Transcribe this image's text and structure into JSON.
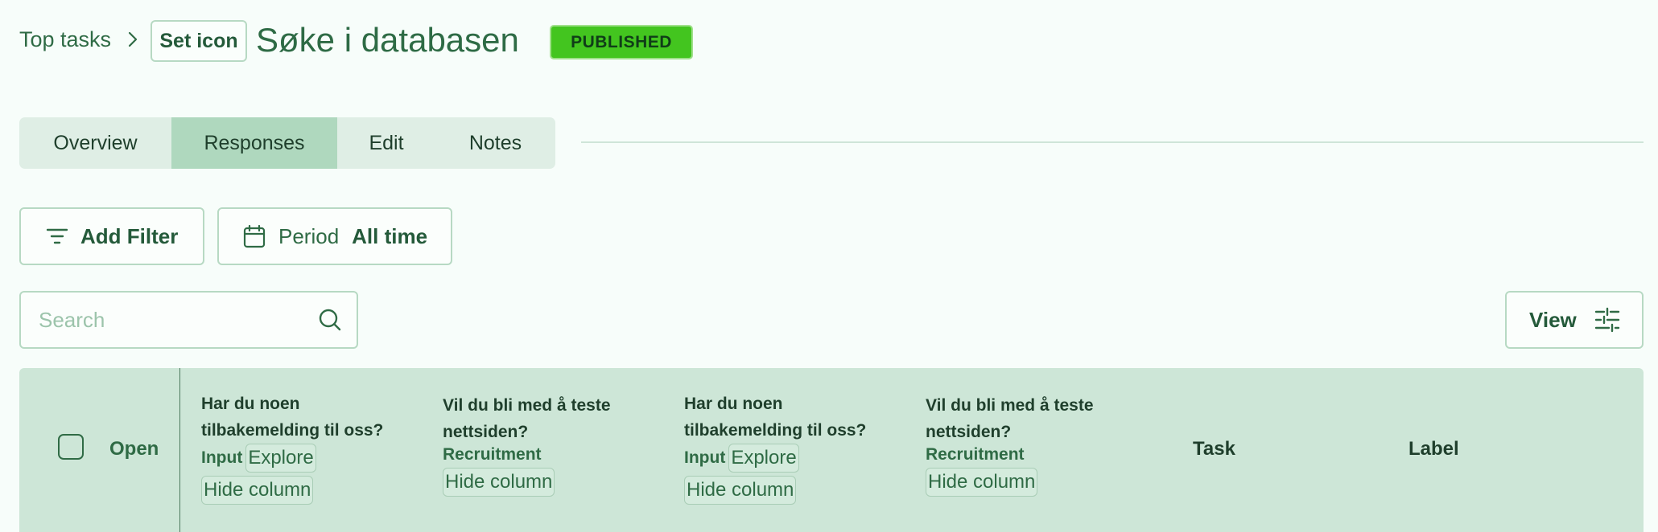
{
  "breadcrumb": {
    "parent": "Top tasks",
    "set_icon": "Set icon",
    "title": "Søke i databasen",
    "status": "PUBLISHED"
  },
  "tabs": [
    {
      "label": "Overview",
      "active": false
    },
    {
      "label": "Responses",
      "active": true
    },
    {
      "label": "Edit",
      "active": false
    },
    {
      "label": "Notes",
      "active": false
    }
  ],
  "filters": {
    "add_filter": "Add Filter",
    "period_label": "Period",
    "period_value": "All time"
  },
  "search": {
    "placeholder": "Search",
    "value": ""
  },
  "view": {
    "label": "View"
  },
  "table": {
    "open_label": "Open",
    "columns": [
      {
        "question": "Har du noen tilbakemelding til oss?",
        "tag": "Input",
        "explore": "Explore",
        "hide": "Hide column"
      },
      {
        "question": "Vil du bli med å teste nettsiden?",
        "tag": "Recruitment",
        "hide": "Hide column"
      },
      {
        "question": "Har du noen tilbakemelding til oss?",
        "tag": "Input",
        "explore": "Explore",
        "hide": "Hide column"
      },
      {
        "question": "Vil du bli med å teste nettsiden?",
        "tag": "Recruitment",
        "hide": "Hide column"
      }
    ],
    "task_header": "Task",
    "label_header": "Label"
  },
  "colors": {
    "background": "#f7fdfa",
    "accent": "#2f6b45",
    "badge": "#43c51f",
    "tab_active": "#afd8be",
    "table_header": "#cde6d7"
  }
}
